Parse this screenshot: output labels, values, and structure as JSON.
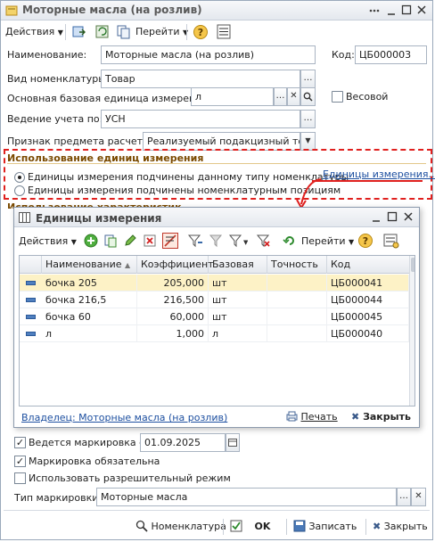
{
  "window": {
    "title": "Моторные масла (на розлив)",
    "toolbar": {
      "actions_label": "Действия",
      "goto_label": "Перейти"
    }
  },
  "form": {
    "name_label": "Наименование:",
    "name_value": "Моторные масла (на розлив)",
    "code_label": "Код:",
    "code_value": "ЦБ000003",
    "type_label": "Вид номенклатуры:",
    "type_value": "Товар",
    "unit_label": "Основная базовая единица измерения:",
    "unit_value": "л",
    "weight_label": "Весовой",
    "accounting_label": "Ведение учета по:",
    "accounting_value": "УСН",
    "subject_label": "Признак предмета расчета:",
    "subject_value": "Реализуемый подакцизный товар"
  },
  "units_section": {
    "title": "Использование единиц измерения",
    "radio1": "Единицы измерения подчинены данному типу номенклатуры",
    "radio2": "Единицы измерения подчинены номенклатурным позициям",
    "link": "Единицы измерения..."
  },
  "behind": {
    "chars_title": "Использование характеристик"
  },
  "subwindow": {
    "title": "Единицы измерения",
    "actions_label": "Действия",
    "goto_label": "Перейти",
    "columns": [
      "Наименование",
      "Коэффициент",
      "Базовая",
      "Точность",
      "Код"
    ],
    "rows": [
      {
        "name": "бочка 205",
        "coef": "205,000",
        "base": "шт",
        "prec": "",
        "code": "ЦБ000041"
      },
      {
        "name": "бочка 216,5",
        "coef": "216,500",
        "base": "шт",
        "prec": "",
        "code": "ЦБ000044"
      },
      {
        "name": "бочка 60",
        "coef": "60,000",
        "base": "шт",
        "prec": "",
        "code": "ЦБ000045"
      },
      {
        "name": "л",
        "coef": "1,000",
        "base": "л",
        "prec": "",
        "code": "ЦБ000040"
      }
    ],
    "owner_link": "Владелец: Моторные масла (на розлив)",
    "print_label": "Печать",
    "close_label": "Закрыть"
  },
  "marking": {
    "marked_label": "Ведется маркировка с",
    "marked_date": "01.09.2025",
    "required_label": "Маркировка обязательна",
    "permissive_label": "Использовать разрешительный режим",
    "type_label": "Тип маркировки:",
    "type_value": "Моторные масла"
  },
  "footer": {
    "nomenclature_label": "Номенклатура",
    "ok_label": "OK",
    "save_label": "Записать",
    "close_label": "Закрыть"
  },
  "colors": {
    "accent_red": "#e0201e",
    "section_brown": "#7a4a00",
    "link_blue": "#1d4fa0",
    "selected_row": "#fdf2c6"
  }
}
